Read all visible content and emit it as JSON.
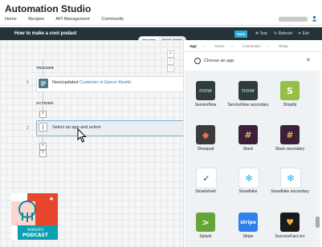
{
  "app_title": "Automation Studio",
  "nav": [
    "Home",
    "Recipes",
    "API Management",
    "Community"
  ],
  "toolbar": {
    "recipe_name": "How to make a cool podast",
    "segment": [
      "RECIPE",
      "TEST JOBS"
    ],
    "save": "Save",
    "test": "Test",
    "refresh": "Refresh",
    "exit": "Exit"
  },
  "canvas": {
    "trigger_label": "TRIGGER",
    "actions_label": "ACTIONS",
    "step1": {
      "num": "1",
      "prefix": "New/updated ",
      "app": "Customer in Epicor Kinetic"
    },
    "step2": {
      "num": "2",
      "text": "Select an app and action"
    }
  },
  "panel": {
    "steps": [
      "App",
      "Action",
      "Connection",
      "Setup"
    ],
    "search_placeholder": "Choose an app",
    "apps": [
      {
        "name": "ServiceNow",
        "color": "#2f3b3c",
        "glyph": "now"
      },
      {
        "name": "ServiceNow secondary",
        "color": "#2f3b3c",
        "glyph": "now"
      },
      {
        "name": "Shopify",
        "color": "#95bf47",
        "glyph": "S"
      },
      {
        "name": "Showpad",
        "color": "#3b3b3b",
        "glyph": "◆"
      },
      {
        "name": "Slack",
        "color": "#3b1f3b",
        "glyph": "#"
      },
      {
        "name": "Slack secondary",
        "color": "#3b1f3b",
        "glyph": "#"
      },
      {
        "name": "Smartsheet",
        "color": "#ffffff",
        "glyph": "✓"
      },
      {
        "name": "Snowflake",
        "color": "#ffffff",
        "glyph": "✻"
      },
      {
        "name": "Snowflake secondary",
        "color": "#ffffff",
        "glyph": "✻"
      },
      {
        "name": "Splunk",
        "color": "#65a637",
        "glyph": ">"
      },
      {
        "name": "Stripe",
        "color": "#2f80ed",
        "glyph": "stripe"
      },
      {
        "name": "SuccessFact ors",
        "color": "#1a1a1a",
        "glyph": "♥"
      }
    ]
  },
  "podcast": {
    "brand": "WORKATO",
    "title": "PODCAST"
  }
}
